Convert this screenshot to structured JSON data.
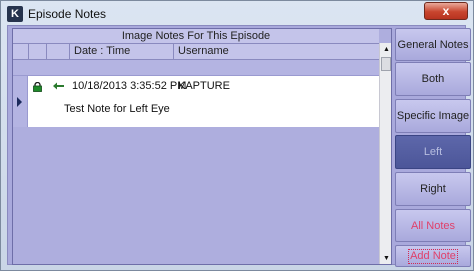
{
  "window": {
    "title": "Episode Notes",
    "icon_letter": "K",
    "close_label": "x"
  },
  "grid": {
    "caption": "Image Notes For This Episode",
    "columns": [
      "Date : Time",
      "Username"
    ],
    "rows": [
      {
        "datetime": "10/18/2013 3:35:52 PM",
        "username": "KAPTURE",
        "note": "Test Note for Left Eye",
        "locked": true
      }
    ],
    "scroll_up": "▲",
    "scroll_down": "▼"
  },
  "buttons": {
    "general_notes": "General Notes",
    "both": "Both",
    "specific_image": "Specific Image",
    "left": "Left",
    "right": "Right",
    "all_notes": "All Notes",
    "add_note": "Add Note"
  },
  "colors": {
    "accent_pink": "#e0406a",
    "active_button": "#4c5699",
    "lock_green": "#1f8a2a"
  }
}
